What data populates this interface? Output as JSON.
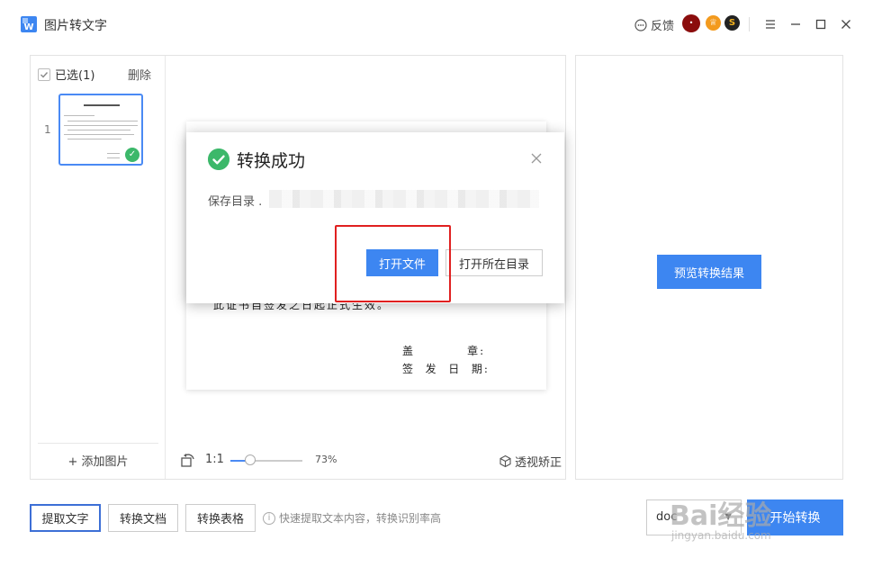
{
  "app": {
    "title": "图片转文字",
    "logo_icon": "document-w-icon"
  },
  "topbar": {
    "feedback_label": "反馈",
    "avatar_text": "•",
    "icons": [
      "chat-icon",
      "avatar",
      "crown-badge-icon",
      "s-badge-icon",
      "menu-icon",
      "minimize-icon",
      "maximize-icon",
      "close-icon"
    ]
  },
  "thumbnails": {
    "select_label": "已选(1)",
    "delete_label": "删除",
    "items": [
      {
        "index": "1",
        "selected": true
      }
    ],
    "add_label": "添加图片"
  },
  "document": {
    "lines": [
      "此证书自签发之日起正式生效。",
      "盖          章:",
      "签  发  日  期:"
    ]
  },
  "viewer": {
    "ratio_label": "1:1",
    "zoom": {
      "value_label": "73%",
      "level": 0.27
    },
    "perspective_label": "透视矫正"
  },
  "preview": {
    "button_label": "预览转换结果"
  },
  "modes": {
    "extract_text": "提取文字",
    "convert_doc": "转换文档",
    "convert_table": "转换表格",
    "active": "extract_text"
  },
  "hint_text": "快速提取文本内容，转换识别率高",
  "output": {
    "format_value": "doc",
    "start_label": "开始转换"
  },
  "dialog": {
    "title": "转换成功",
    "save_dir_label": "保存目录 .",
    "open_file_label": "打开文件",
    "open_dir_label": "打开所在目录"
  },
  "watermark": {
    "brand": "Bai经验",
    "url": "jingyan.baidu.com"
  },
  "colors": {
    "accent": "#3d86f1",
    "success": "#3cb86a",
    "highlight_box": "#e02020"
  }
}
